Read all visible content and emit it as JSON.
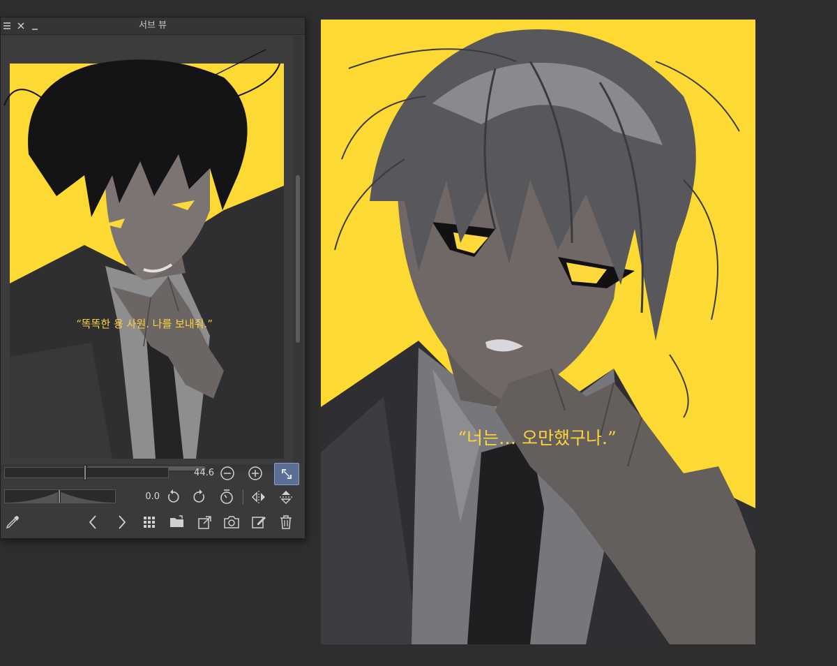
{
  "subview": {
    "title": "서브 뷰",
    "zoom_value": "44.6",
    "zoom_level": 44.6,
    "angle_value": "0.0",
    "angle_level": 0.0,
    "preview_caption": "“똑똑한 용 사원. 나를 보내줘.”"
  },
  "canvas": {
    "caption": "“너는… 오만했구나.”"
  },
  "colors": {
    "app_background": "#2e2e2e",
    "panel_background": "#3a3a3a",
    "art_yellow": "#fcd933",
    "caption_yellow": "#ffd43b",
    "active_button": "#5b6f95"
  },
  "icons": [
    "menu-icon",
    "close-icon",
    "minimize-icon",
    "zoom-out-icon",
    "zoom-in-icon",
    "fit-view-icon",
    "rotate-left-icon",
    "rotate-right-icon",
    "reset-rotation-icon",
    "flip-horizontal-icon",
    "flip-vertical-icon",
    "eyedropper-icon",
    "previous-image-icon",
    "next-image-icon",
    "thumbnail-grid-icon",
    "open-folder-icon",
    "import-icon",
    "camera-icon",
    "edit-icon",
    "delete-icon"
  ]
}
